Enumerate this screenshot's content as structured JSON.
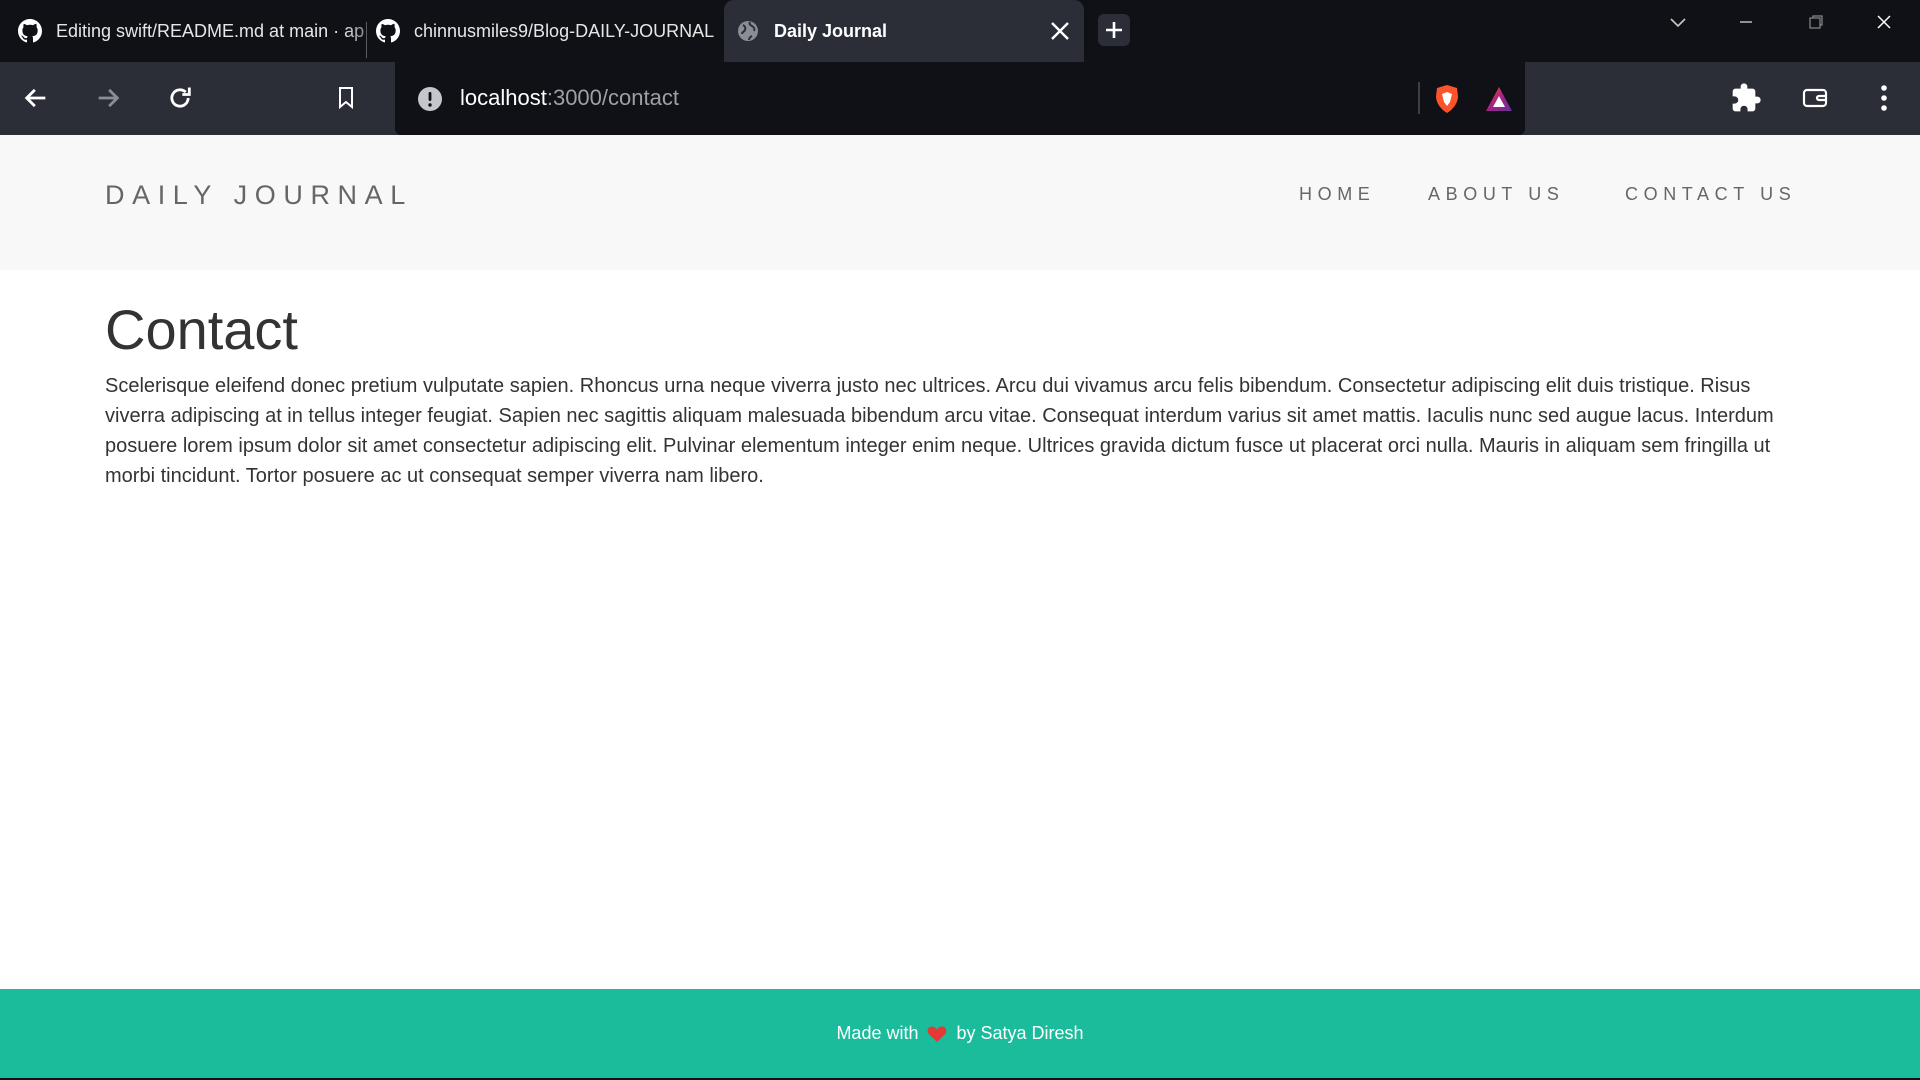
{
  "browser": {
    "tabs": [
      {
        "title": "Editing swift/README.md at main · ap",
        "icon": "github-icon"
      },
      {
        "title": "chinnusmiles9/Blog-DAILY-JOURNAL",
        "icon": "github-icon"
      },
      {
        "title": "Daily Journal",
        "icon": "globe-icon",
        "active": true
      }
    ],
    "url_host": "localhost",
    "url_path": ":3000/contact",
    "colors": {
      "tabstrip": "#0f1117",
      "toolbar": "#2b2d37",
      "brave_orange": "#fb542b"
    }
  },
  "site": {
    "brand": "DAILY JOURNAL",
    "nav": {
      "home": "HOME",
      "about": "ABOUT US",
      "contact": "CONTACT US"
    }
  },
  "page": {
    "heading": "Contact",
    "body": "Scelerisque eleifend donec pretium vulputate sapien. Rhoncus urna neque viverra justo nec ultrices. Arcu dui vivamus arcu felis bibendum. Consectetur adipiscing elit duis tristique. Risus viverra adipiscing at in tellus integer feugiat. Sapien nec sagittis aliquam malesuada bibendum arcu vitae. Consequat interdum varius sit amet mattis. Iaculis nunc sed augue lacus. Interdum posuere lorem ipsum dolor sit amet consectetur adipiscing elit. Pulvinar elementum integer enim neque. Ultrices gravida dictum fusce ut placerat orci nulla. Mauris in aliquam sem fringilla ut morbi tincidunt. Tortor posuere ac ut consequat semper viverra nam libero."
  },
  "footer": {
    "prefix": "Made with",
    "suffix": "by Satya Diresh",
    "color": "#1abc9c",
    "heart_color": "#e53935"
  }
}
